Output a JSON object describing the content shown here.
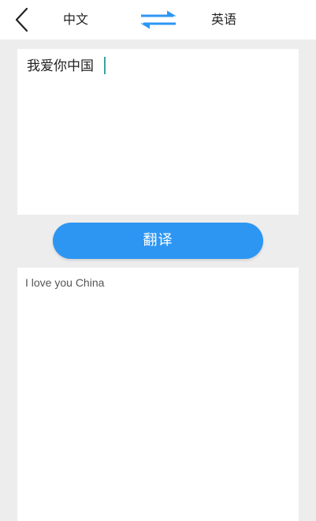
{
  "header": {
    "source_language": "中文",
    "target_language": "英语",
    "back_icon": "chevron-left-icon",
    "swap_icon": "swap-arrows-icon",
    "accent_color": "#2d96f3"
  },
  "input": {
    "value": "我爱你中国"
  },
  "actions": {
    "translate_label": "翻译",
    "translate_color": "#2d96f3"
  },
  "output": {
    "text": "I love you China"
  }
}
